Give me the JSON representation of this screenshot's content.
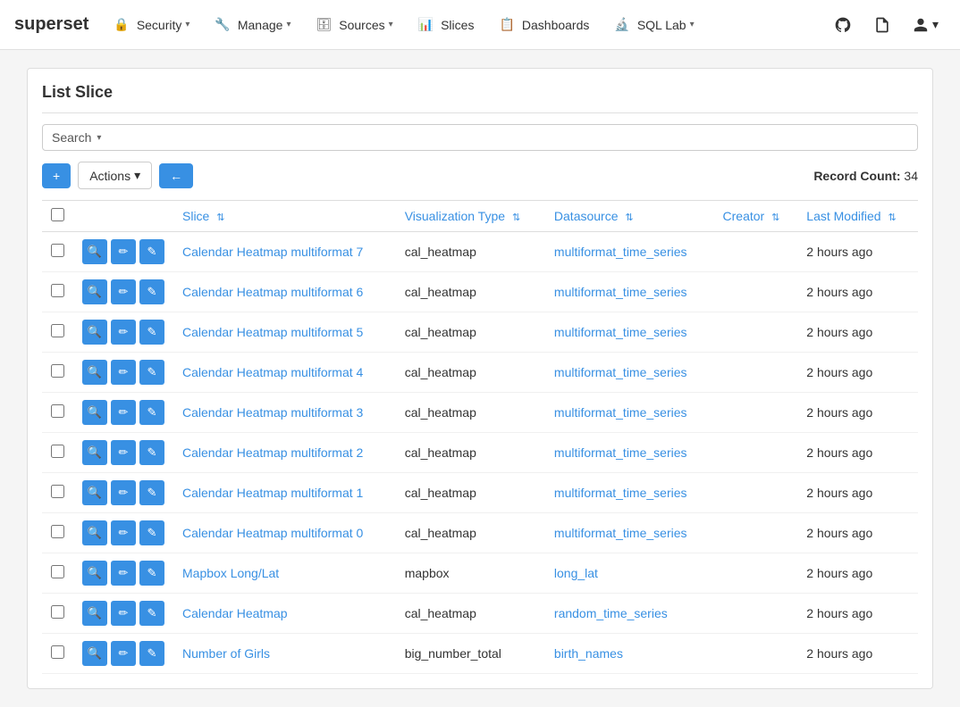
{
  "app": {
    "brand": "superset"
  },
  "navbar": {
    "items": [
      {
        "id": "security",
        "label": "Security",
        "icon": "🔒",
        "hasDropdown": true
      },
      {
        "id": "manage",
        "label": "Manage",
        "icon": "🔧",
        "hasDropdown": true
      },
      {
        "id": "sources",
        "label": "Sources",
        "icon": "🗄",
        "hasDropdown": true
      },
      {
        "id": "slices",
        "label": "Slices",
        "icon": "📊",
        "hasDropdown": false
      },
      {
        "id": "dashboards",
        "label": "Dashboards",
        "icon": "📋",
        "hasDropdown": false
      },
      {
        "id": "sqllab",
        "label": "SQL Lab",
        "icon": "🔬",
        "hasDropdown": true
      }
    ],
    "right": {
      "github_icon": "⊕",
      "docs_icon": "📄",
      "user_caret": "▼"
    }
  },
  "page": {
    "title": "List Slice",
    "search_label": "Search",
    "search_caret": "▾",
    "toolbar": {
      "add_label": "+",
      "actions_label": "Actions",
      "actions_caret": "▾",
      "back_icon": "←",
      "record_count_label": "Record Count:",
      "record_count": "34"
    },
    "table": {
      "columns": [
        {
          "id": "slice",
          "label": "Slice",
          "sortable": true
        },
        {
          "id": "viz_type",
          "label": "Visualization Type",
          "sortable": true
        },
        {
          "id": "datasource",
          "label": "Datasource",
          "sortable": true
        },
        {
          "id": "creator",
          "label": "Creator",
          "sortable": true
        },
        {
          "id": "last_modified",
          "label": "Last Modified",
          "sortable": true
        }
      ],
      "rows": [
        {
          "id": 1,
          "slice": "Calendar Heatmap multiformat 7",
          "viz_type": "cal_heatmap",
          "datasource": "multiformat_time_series",
          "creator": "",
          "last_modified": "2 hours ago"
        },
        {
          "id": 2,
          "slice": "Calendar Heatmap multiformat 6",
          "viz_type": "cal_heatmap",
          "datasource": "multiformat_time_series",
          "creator": "",
          "last_modified": "2 hours ago"
        },
        {
          "id": 3,
          "slice": "Calendar Heatmap multiformat 5",
          "viz_type": "cal_heatmap",
          "datasource": "multiformat_time_series",
          "creator": "",
          "last_modified": "2 hours ago"
        },
        {
          "id": 4,
          "slice": "Calendar Heatmap multiformat 4",
          "viz_type": "cal_heatmap",
          "datasource": "multiformat_time_series",
          "creator": "",
          "last_modified": "2 hours ago"
        },
        {
          "id": 5,
          "slice": "Calendar Heatmap multiformat 3",
          "viz_type": "cal_heatmap",
          "datasource": "multiformat_time_series",
          "creator": "",
          "last_modified": "2 hours ago"
        },
        {
          "id": 6,
          "slice": "Calendar Heatmap multiformat 2",
          "viz_type": "cal_heatmap",
          "datasource": "multiformat_time_series",
          "creator": "",
          "last_modified": "2 hours ago"
        },
        {
          "id": 7,
          "slice": "Calendar Heatmap multiformat 1",
          "viz_type": "cal_heatmap",
          "datasource": "multiformat_time_series",
          "creator": "",
          "last_modified": "2 hours ago"
        },
        {
          "id": 8,
          "slice": "Calendar Heatmap multiformat 0",
          "viz_type": "cal_heatmap",
          "datasource": "multiformat_time_series",
          "creator": "",
          "last_modified": "2 hours ago"
        },
        {
          "id": 9,
          "slice": "Mapbox Long/Lat",
          "viz_type": "mapbox",
          "datasource": "long_lat",
          "creator": "",
          "last_modified": "2 hours ago"
        },
        {
          "id": 10,
          "slice": "Calendar Heatmap",
          "viz_type": "cal_heatmap",
          "datasource": "random_time_series",
          "creator": "",
          "last_modified": "2 hours ago"
        },
        {
          "id": 11,
          "slice": "Number of Girls",
          "viz_type": "big_number_total",
          "datasource": "birth_names",
          "creator": "",
          "last_modified": "2 hours ago"
        }
      ],
      "row_actions": {
        "preview_icon": "🔍",
        "edit_icon": "✏",
        "delete_icon": "✎"
      }
    }
  }
}
